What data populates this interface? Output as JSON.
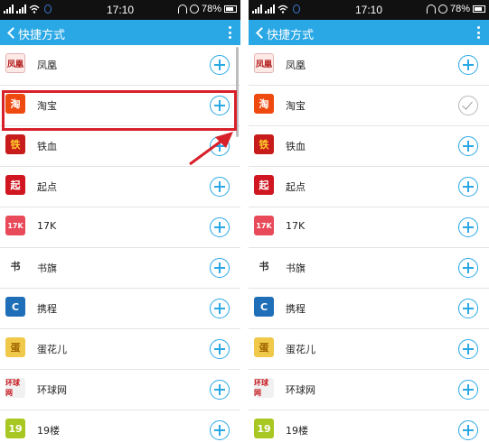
{
  "status_bar": {
    "time": "17:10",
    "battery": "78%"
  },
  "app_bar": {
    "title": "快捷方式"
  },
  "logo_text": {
    "fenghuang": "凤凰",
    "taobao": "淘",
    "tiexue": "铁",
    "qidian": "起",
    "k17": "17K",
    "shuqi": "书",
    "xiecheng": "C",
    "danhuar": "蛋",
    "huanqiu": "环球网",
    "l19": "19"
  },
  "left_list": [
    {
      "label": "凤凰",
      "action": "add"
    },
    {
      "label": "淘宝",
      "action": "add"
    },
    {
      "label": "铁血",
      "action": "add"
    },
    {
      "label": "起点",
      "action": "add"
    },
    {
      "label": "17K",
      "action": "add"
    },
    {
      "label": "书旗",
      "action": "add"
    },
    {
      "label": "携程",
      "action": "add"
    },
    {
      "label": "蛋花儿",
      "action": "add"
    },
    {
      "label": "环球网",
      "action": "add"
    },
    {
      "label": "19楼",
      "action": "add"
    }
  ],
  "right_list": [
    {
      "label": "凤凰",
      "action": "add"
    },
    {
      "label": "淘宝",
      "action": "added"
    },
    {
      "label": "铁血",
      "action": "add"
    },
    {
      "label": "起点",
      "action": "add"
    },
    {
      "label": "17K",
      "action": "add"
    },
    {
      "label": "书旗",
      "action": "add"
    },
    {
      "label": "携程",
      "action": "add"
    },
    {
      "label": "蛋花儿",
      "action": "add"
    },
    {
      "label": "环球网",
      "action": "add"
    },
    {
      "label": "19楼",
      "action": "add"
    }
  ],
  "colors": {
    "accent": "#2aa8e6",
    "highlight": "#d8202a",
    "status_bar": "#111111"
  }
}
